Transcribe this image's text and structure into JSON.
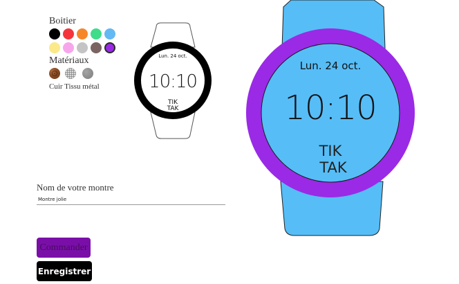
{
  "case_section": {
    "title": "Boitier",
    "colors": [
      {
        "name": "black",
        "hex": "#000000",
        "selected": false
      },
      {
        "name": "red",
        "hex": "#f5353c",
        "selected": false
      },
      {
        "name": "orange",
        "hex": "#f5872a",
        "selected": false
      },
      {
        "name": "green",
        "hex": "#3fdc8b",
        "selected": false
      },
      {
        "name": "sky-blue",
        "hex": "#62b9f4",
        "selected": false
      },
      {
        "name": "yellow",
        "hex": "#fbe98a",
        "selected": false
      },
      {
        "name": "pink",
        "hex": "#f8a6ec",
        "selected": false
      },
      {
        "name": "light-gray",
        "hex": "#c4c4c4",
        "selected": false
      },
      {
        "name": "brown",
        "hex": "#7a6562",
        "selected": false
      },
      {
        "name": "purple",
        "hex": "#9a2ae6",
        "selected": true
      }
    ]
  },
  "materials_section": {
    "title": "Matériaux",
    "caption": "Cuir Tissu métal",
    "options": [
      {
        "name": "leather",
        "icon": "leather-texture-icon"
      },
      {
        "name": "fabric",
        "icon": "fabric-texture-icon"
      },
      {
        "name": "metal",
        "icon": "metal-texture-icon"
      }
    ]
  },
  "preview_small": {
    "date": "Lun.  24 oct.",
    "time": "10:10",
    "logo_line1": "TIK",
    "logo_line2": "TAK",
    "case_color": "#000000",
    "screen_color": "#ffffff",
    "strap_color": "#ffffff"
  },
  "preview_large": {
    "date": "Lun.  24 oct.",
    "time": "10:10",
    "logo_line1": "TIK",
    "logo_line2": "TAK",
    "case_color": "#9a2ae6",
    "screen_color": "#56bdf7",
    "strap_color": "#56bdf7"
  },
  "name_section": {
    "label": "Nom de votre montre",
    "value": "Montre jolie"
  },
  "actions": {
    "order_label": "Commander",
    "save_label": "Enregistrer"
  }
}
